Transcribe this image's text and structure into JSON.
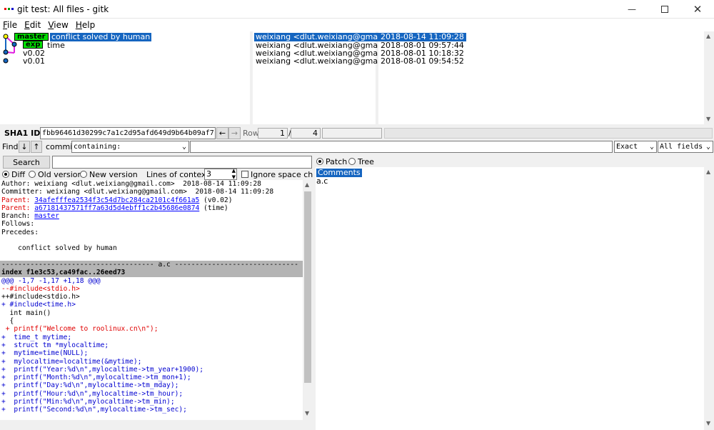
{
  "window": {
    "title": "git test: All files - gitk",
    "controls": [
      "minimize",
      "maximize",
      "close"
    ]
  },
  "menu": [
    "File",
    "Edit",
    "View",
    "Help"
  ],
  "commits": [
    {
      "refs": [
        "master",
        "exp"
      ],
      "subject": "conflict solved by human",
      "author": "weixiang <dlut.weixiang@gmail.com>",
      "date": "2018-08-14 11:09:28",
      "selected": true
    },
    {
      "refs": [],
      "subject": "time",
      "author": "weixiang <dlut.weixiang@gmail.com>",
      "date": "2018-08-01 09:57:44"
    },
    {
      "refs": [],
      "subject": "v0.02",
      "author": "weixiang <dlut.weixiang@gmail.com>",
      "date": "2018-08-01 10:18:32"
    },
    {
      "refs": [],
      "subject": "v0.01",
      "author": "weixiang <dlut.weixiang@gmail.com>",
      "date": "2018-08-01 09:54:52"
    }
  ],
  "sha": {
    "label": "SHA1 ID:",
    "value": "fbb96461d30299c7a1c2d95afd649d9b64b09af7",
    "row_label": "Row",
    "row_current": "1",
    "row_sep": "/",
    "row_total": "4"
  },
  "find": {
    "label": "Find",
    "type": "commit",
    "mode": "containing:",
    "match": "Exact",
    "fields": "All fields"
  },
  "search": {
    "button": "Search"
  },
  "diff_options": {
    "diff": "Diff",
    "old": "Old version",
    "new": "New version",
    "context_label": "Lines of context:",
    "context_value": "3",
    "ignore_space": "Ignore space chang"
  },
  "right_options": {
    "patch": "Patch",
    "tree": "Tree"
  },
  "files": {
    "comments": "Comments",
    "list": [
      "a.c"
    ]
  },
  "details": {
    "author": "Author: weixiang <dlut.weixiang@gmail.com>  2018-08-14 11:09:28",
    "committer": "Committer: weixiang <dlut.weixiang@gmail.com>  2018-08-14 11:09:28",
    "parent1_label": "Parent: ",
    "parent1_hash": "34afefffea2534f3c54d7bc284ca2101c4f661a5",
    "parent1_tag": " (v0.02)",
    "parent2_label": "Parent: ",
    "parent2_hash": "a67181437571ff7a63d5d4ebff1c2b45686e0874",
    "parent2_tag": " (time)",
    "branch_label": "Branch: ",
    "branch": "master",
    "follows": "Follows:",
    "precedes": "Precedes:",
    "message": "    conflict solved by human",
    "file_header": "------------------------------------- a.c ------------------------------",
    "index_line": "index f1e3c53,ca49fac..26eed73",
    "hunk": "@@@ -1,7 -1,17 +1,18 @@@",
    "lines": [
      {
        "t": "--#include<stdio.h>",
        "c": "red"
      },
      {
        "t": "++#include<stdio.h>",
        "c": ""
      },
      {
        "t": "+ #include<time.h>",
        "c": "blue"
      },
      {
        "t": "  int main()",
        "c": ""
      },
      {
        "t": "  {",
        "c": ""
      },
      {
        "t": " + printf(\"Welcome to roolinux.cn\\n\");",
        "c": "red"
      },
      {
        "t": "+  time_t mytime;",
        "c": "blue"
      },
      {
        "t": "+  struct tm *mylocaltime;",
        "c": "blue"
      },
      {
        "t": "+  mytime=time(NULL);",
        "c": "blue"
      },
      {
        "t": "+  mylocaltime=localtime(&mytime);",
        "c": "blue"
      },
      {
        "t": "+  printf(\"Year:%d\\n\",mylocaltime->tm_year+1900);",
        "c": "blue"
      },
      {
        "t": "+  printf(\"Month:%d\\n\",mylocaltime->tm_mon+1);",
        "c": "blue"
      },
      {
        "t": "+  printf(\"Day:%d\\n\",mylocaltime->tm_mday);",
        "c": "blue"
      },
      {
        "t": "+  printf(\"Hour:%d\\n\",mylocaltime->tm_hour);",
        "c": "blue"
      },
      {
        "t": "+  printf(\"Min:%d\\n\",mylocaltime->tm_min);",
        "c": "blue"
      },
      {
        "t": "+  printf(\"Second:%d\\n\",mylocaltime->tm_sec);",
        "c": "blue"
      }
    ]
  },
  "colors": {
    "selection": "#1565c0",
    "master_tag": "#00e000",
    "link": "#0000ff",
    "removed": "#e00000",
    "added": "#0000d0"
  }
}
